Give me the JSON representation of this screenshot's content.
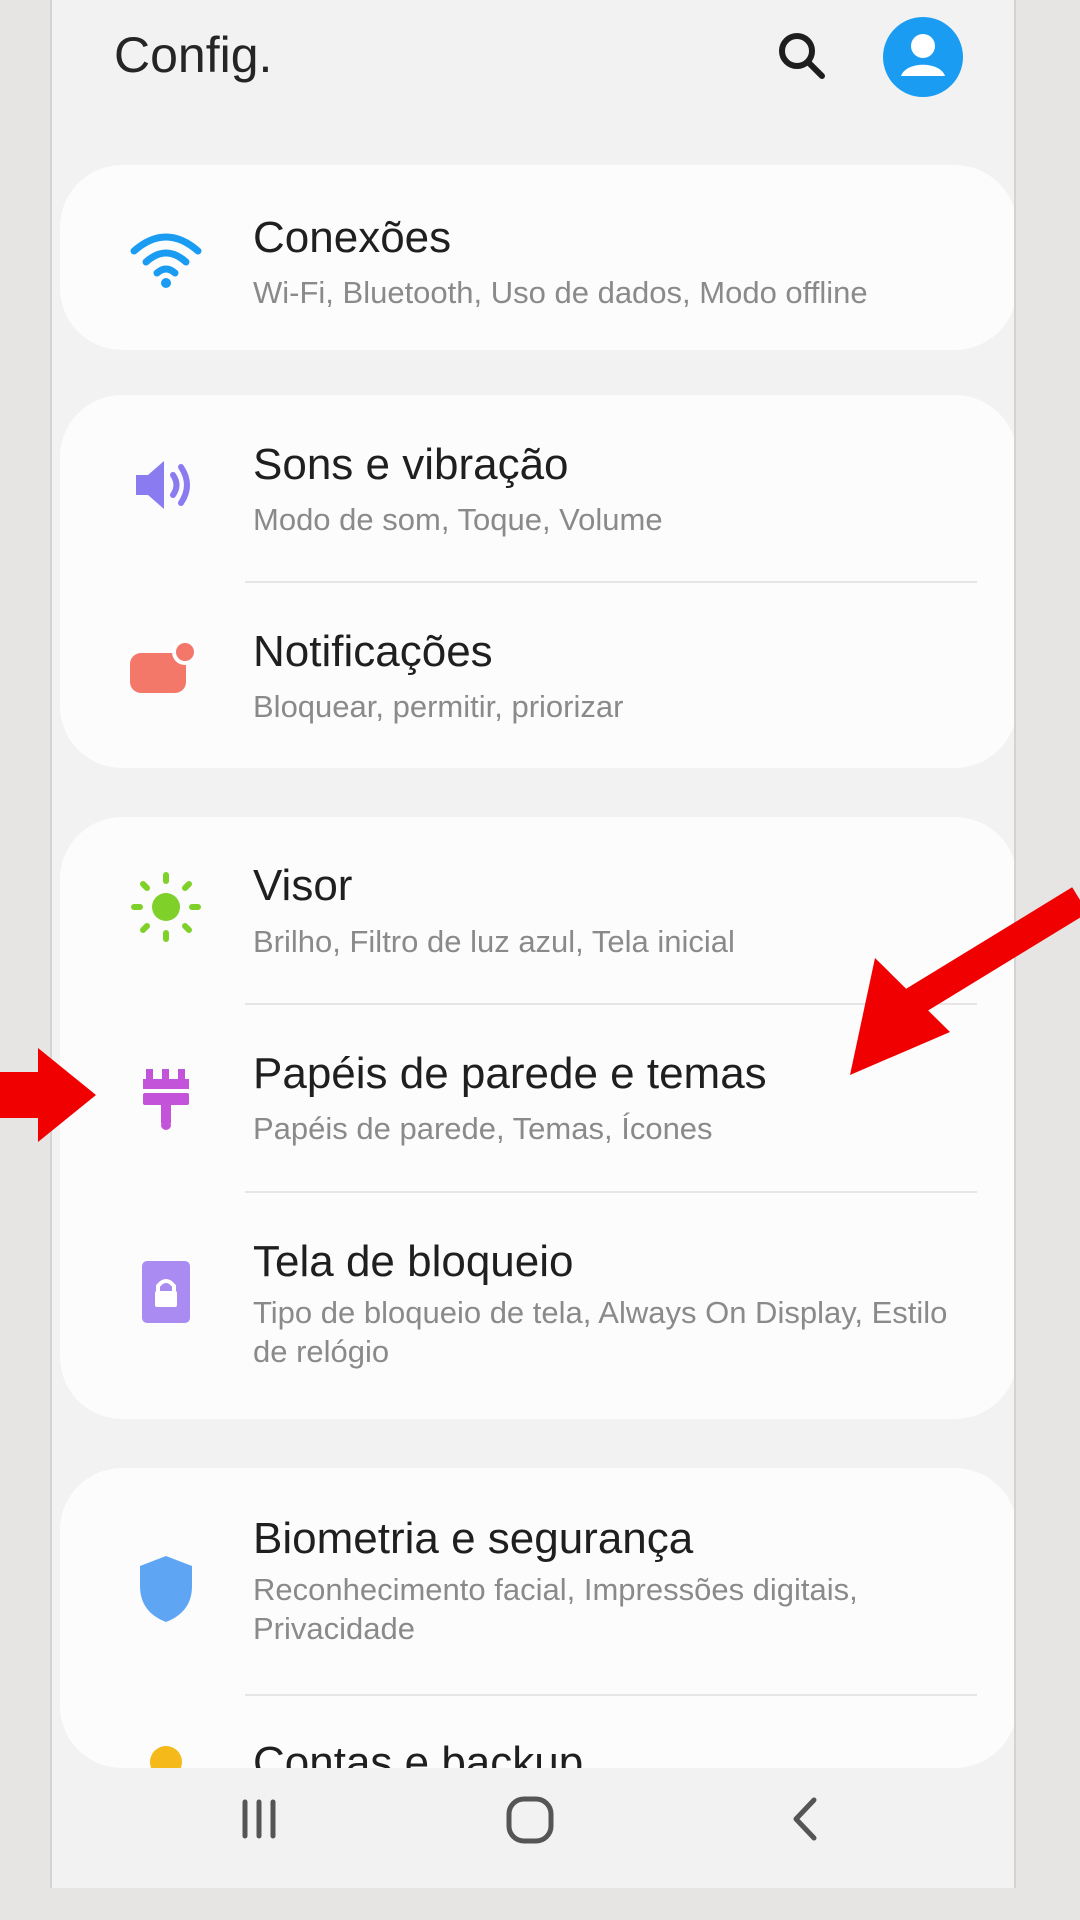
{
  "header": {
    "title": "Config.",
    "search_icon": "search-icon",
    "account_icon": "account-icon"
  },
  "settings": {
    "conexoes": {
      "title": "Conexões",
      "subtitle": "Wi-Fi, Bluetooth, Uso de dados, Modo offline",
      "icon": "wifi-icon",
      "color": "#1a9cf2"
    },
    "sons": {
      "title": "Sons e vibração",
      "subtitle": "Modo de som, Toque, Volume",
      "icon": "speaker-icon",
      "color": "#8a7cf0"
    },
    "notificacoes": {
      "title": "Notificações",
      "subtitle": "Bloquear, permitir, priorizar",
      "icon": "notification-icon",
      "color": "#f4786a"
    },
    "visor": {
      "title": "Visor",
      "subtitle": "Brilho, Filtro de luz azul, Tela inicial",
      "icon": "sun-icon",
      "color": "#7fd12a"
    },
    "papeis": {
      "title": "Papéis de parede e temas",
      "subtitle": "Papéis de parede, Temas, Ícones",
      "icon": "paintbrush-icon",
      "color": "#c353d8"
    },
    "bloqueio": {
      "title": "Tela de bloqueio",
      "subtitle": "Tipo de bloqueio de tela, Always On Display, Estilo de relógio",
      "icon": "lock-screen-icon",
      "color": "#a98bf2"
    },
    "biometria": {
      "title": "Biometria e segurança",
      "subtitle": "Reconhecimento facial, Impressões digitais, Privacidade",
      "icon": "shield-icon",
      "color": "#5ea6f4"
    },
    "contas": {
      "title": "Contas e backup",
      "icon": "key-icon",
      "color": "#f5b91a"
    }
  },
  "navigation": {
    "recents_icon": "recents-icon",
    "home_icon": "home-icon",
    "back_icon": "back-icon"
  },
  "colors": {
    "accent": "#1a9cf2",
    "annotation_arrow": "#f00000"
  }
}
